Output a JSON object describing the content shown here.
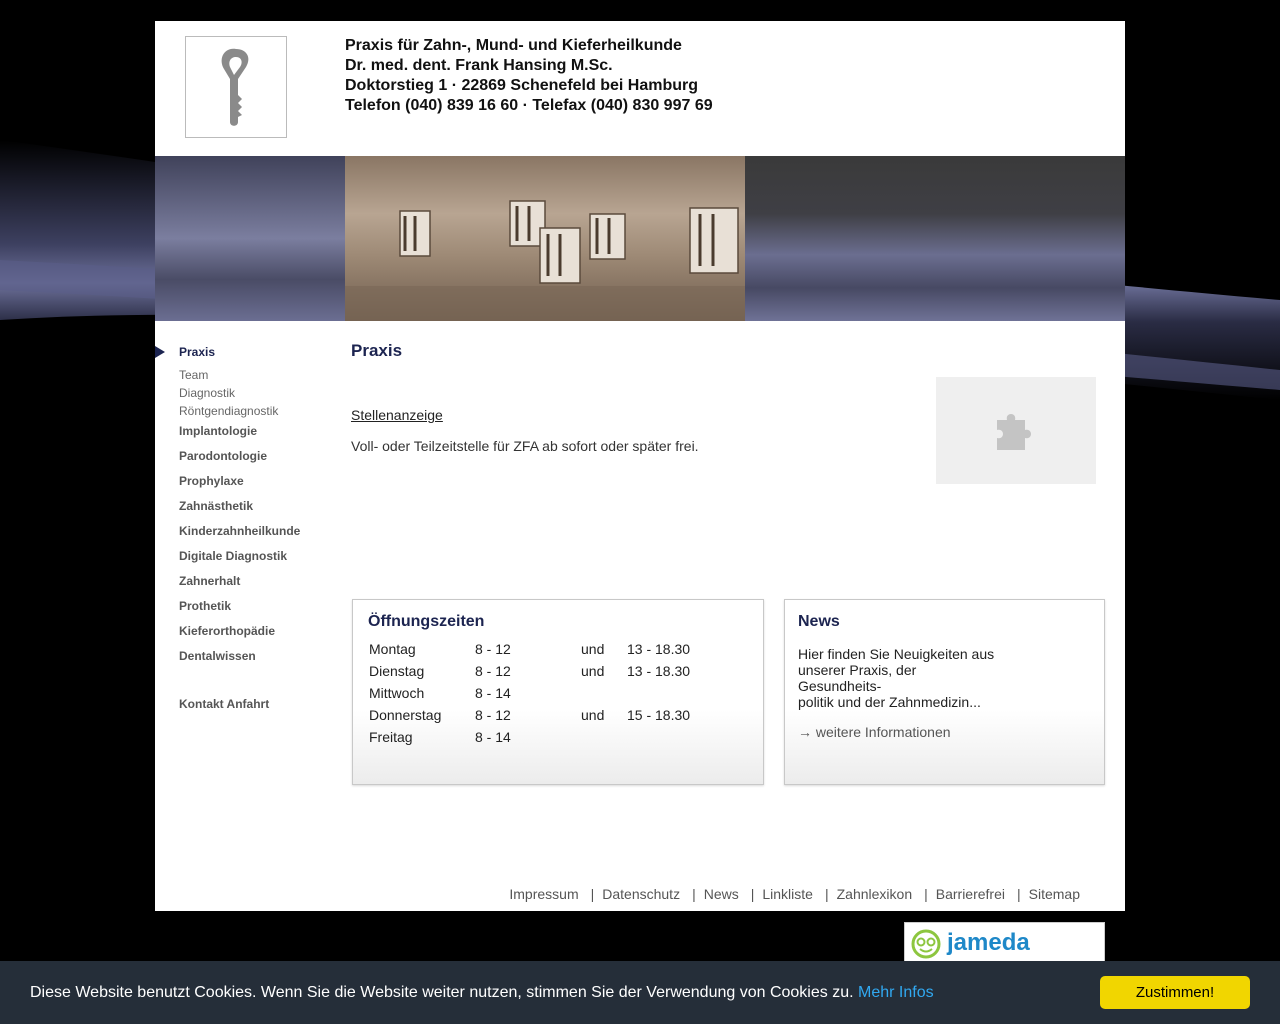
{
  "header": {
    "line1": "Praxis für Zahn-, Mund- und Kieferheilkunde",
    "line2": "Dr. med. dent. Frank Hansing M.Sc.",
    "line3": "Doktorstieg 1 · 22869 Schenefeld bei Hamburg",
    "line4": "Telefon (040) 839 16 60 · Telefax (040) 830 997 69"
  },
  "nav": {
    "main": "Praxis",
    "sub": [
      "Team",
      "Diagnostik",
      "Röntgendiagnostik"
    ],
    "items": [
      "Implantologie",
      "Parodontologie",
      "Prophylaxe",
      "Zahnästhetik",
      "Kinderzahnheilkunde",
      "Digitale Diagnostik",
      "Zahnerhalt",
      "Prothetik",
      "Kieferorthopädie",
      "Dentalwissen"
    ],
    "contact": "Kontakt Anfahrt"
  },
  "content": {
    "title": "Praxis",
    "link": "Stellenanzeige",
    "text": "Voll- oder Teilzeitstelle für ZFA ab sofort oder später frei."
  },
  "hours": {
    "title": "Öffnungszeiten",
    "rows": [
      {
        "day": "Montag",
        "am": "8 - 12",
        "and": "und",
        "pm": "13 - 18.30"
      },
      {
        "day": "Dienstag",
        "am": "8 - 12",
        "and": "und",
        "pm": "13 - 18.30"
      },
      {
        "day": "Mittwoch",
        "am": "8 - 14",
        "and": "",
        "pm": ""
      },
      {
        "day": "Donnerstag",
        "am": "8 - 12",
        "and": "und",
        "pm": "15 - 18.30"
      },
      {
        "day": "Freitag",
        "am": "8 - 14",
        "and": "",
        "pm": ""
      }
    ]
  },
  "news": {
    "title": "News",
    "text1": "Hier finden Sie Neuigkeiten aus",
    "text2": "unserer Praxis, der",
    "text3": "Gesundheits-",
    "text4": "politik und der Zahnmedizin...",
    "link": "→ weitere Informationen"
  },
  "footer": {
    "links": [
      "Impressum",
      "Datenschutz",
      "News",
      "Linkliste",
      "Zahnlexikon",
      "Barrierefrei",
      "Sitemap"
    ],
    "separator": "|"
  },
  "jameda": {
    "label": "jameda"
  },
  "cookie": {
    "text": "Diese Website benutzt Cookies. Wenn Sie die Website weiter nutzen, stimmen Sie der Verwendung von Cookies zu.",
    "link": "Mehr Infos",
    "button": "Zustimmen!"
  },
  "colors": {
    "accent": "#1c2450",
    "cookie_bar": "#252e39",
    "cookie_button": "#f1d600",
    "cookie_link": "#31a8f0"
  }
}
